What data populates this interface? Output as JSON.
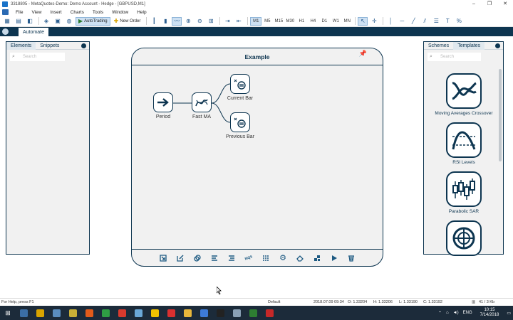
{
  "window": {
    "title": "3318805 - MetaQuotes-Demo: Demo Account - Hedge - [GBPUSD,M1]",
    "controls": [
      "–",
      "❐",
      "✕"
    ]
  },
  "menu": {
    "items": [
      "File",
      "View",
      "Insert",
      "Charts",
      "Tools",
      "Window",
      "Help"
    ],
    "right_icons": [
      "search-icon",
      "chat-icon"
    ]
  },
  "toolbar": {
    "autotrading_label": "AutoTrading",
    "neworder_label": "New Order",
    "timeframes": [
      "M1",
      "M5",
      "M15",
      "M30",
      "H1",
      "H4",
      "D1",
      "W1",
      "MN"
    ],
    "selected_timeframe": "M1"
  },
  "tabs": {
    "active": "Automate"
  },
  "left_panel": {
    "tabs": [
      "Elements",
      "Snippets"
    ],
    "search_placeholder": "Search"
  },
  "right_panel": {
    "tabs": [
      "Schemes",
      "Templates"
    ],
    "search_placeholder": "Search",
    "templates": [
      {
        "name": "Moving Averages Crossover",
        "icon": "ma-crossover-icon"
      },
      {
        "name": "RSI Levels",
        "icon": "rsi-levels-icon"
      },
      {
        "name": "Parabolic SAR",
        "icon": "parabolic-sar-icon"
      },
      {
        "name": "",
        "icon": "roulette-icon"
      }
    ]
  },
  "canvas": {
    "title": "Example",
    "nodes": [
      {
        "label": "Period",
        "icon": "arrow-right-icon"
      },
      {
        "label": "Fast MA",
        "icon": "moving-average-icon"
      },
      {
        "label": "Current Bar",
        "icon": "bar-icon"
      },
      {
        "label": "Previous Bar",
        "icon": "bar-icon"
      }
    ],
    "footer_tools": [
      "export-icon",
      "edit-icon",
      "copy-icon",
      "align-left-icon",
      "align-right-icon",
      "mql5-icon",
      "grid-icon",
      "settings-icon",
      "eraser-icon",
      "arrange-icon",
      "run-icon",
      "delete-icon"
    ],
    "footer_text": {
      "mql5": "MQ5"
    }
  },
  "status": {
    "help": "For Help, press F1",
    "profile": "Default",
    "datetime": "2018.07.09 09:34",
    "open": "O: 1.33204",
    "high": "H: 1.33206",
    "low": "L: 1.33190",
    "close": "C: 1.33192",
    "traffic": "41 / 3 Kb"
  },
  "taskbar": {
    "time": "10:15",
    "date": "7/14/2018",
    "lang": "ENG",
    "apps": [
      "#3b6ea5",
      "#d9a400",
      "#5a8dbf",
      "#c9b037",
      "#e25b1b",
      "#2f9e44",
      "#d83a2e",
      "#6aa8d8",
      "#f2c200",
      "#d93030",
      "#e8b73b",
      "#3d7bd9",
      "#222222",
      "#8aa0b5",
      "#2e7d32",
      "#c62828"
    ]
  },
  "colors": {
    "navy": "#0d3550",
    "panel_bg": "#f1f1f1",
    "taskbar": "#1c2b3a"
  }
}
